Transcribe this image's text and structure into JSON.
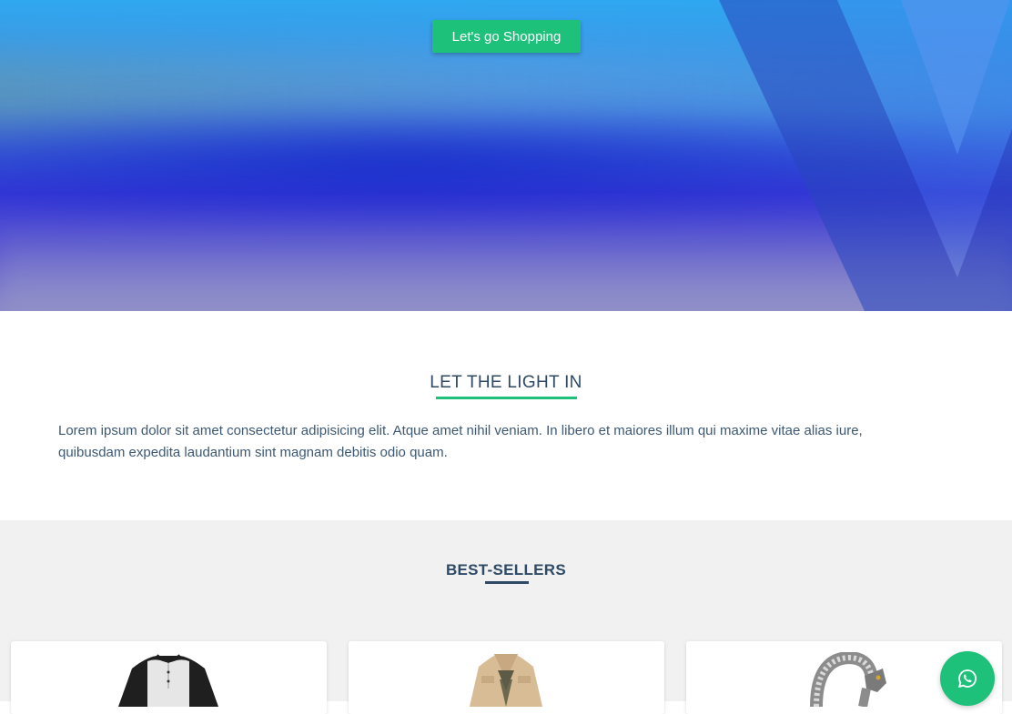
{
  "hero": {
    "button_label": "Let's go Shopping"
  },
  "about": {
    "title": "LET THE LIGHT IN",
    "text": "Lorem ipsum dolor sit amet consectetur adipisicing elit. Atque amet nihil veniam. In libero et maiores illum qui maxime vitae alias iure, quibusdam expedita laudantium sint magnam debitis odio quam."
  },
  "best_sellers": {
    "title": "BEST-SELLERS",
    "products": [
      {
        "image": "henley-shirt-image"
      },
      {
        "image": "jacket-image"
      },
      {
        "image": "dragon-bracelet-image"
      }
    ]
  },
  "chat": {
    "icon": "whatsapp-icon"
  },
  "colors": {
    "accent": "#1ec17a",
    "heading": "#2e4a66",
    "section_bg": "#f1f1f1"
  }
}
